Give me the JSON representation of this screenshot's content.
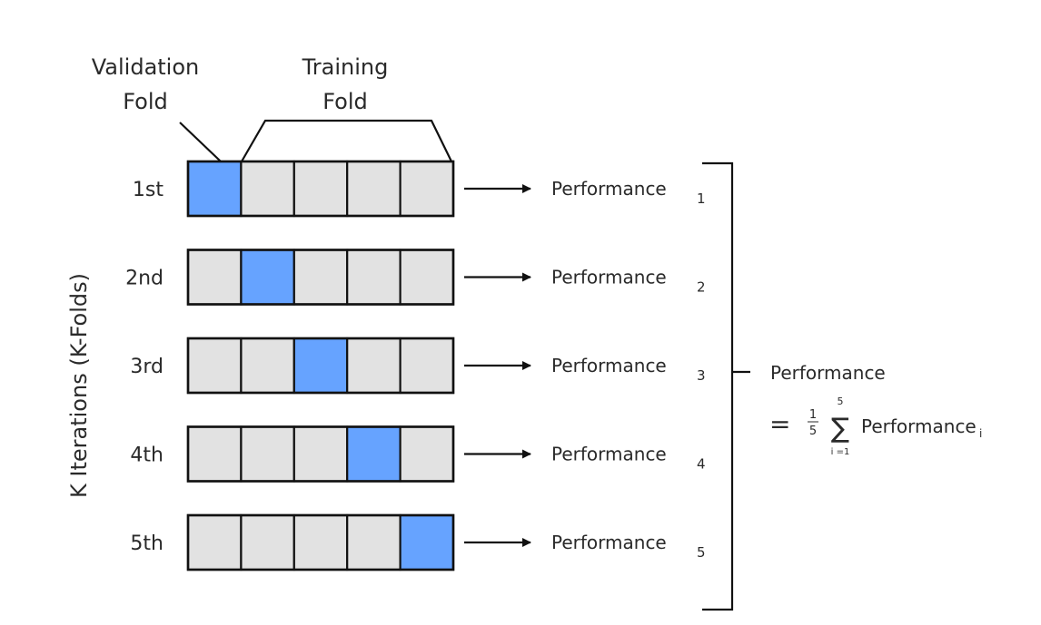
{
  "labels": {
    "validation_fold": [
      "Validation",
      "Fold"
    ],
    "training_fold": [
      "Training",
      "Fold"
    ],
    "y_axis": "K Iterations (K-Folds)",
    "performance_word": "Performance",
    "result_title": "Performance",
    "formula": {
      "equals": "=",
      "frac_num": "1",
      "frac_den": "5",
      "sum_symbol": "∑",
      "sum_upper": "5",
      "sum_lower": "i =1",
      "term": "Performance",
      "term_sub": "i"
    }
  },
  "colors": {
    "validation": "#66a3ff",
    "training": "#e2e2e2",
    "stroke": "#111111"
  },
  "num_folds": 5,
  "iterations": [
    {
      "label": "1st",
      "validation_index": 0,
      "perf_sub": "1"
    },
    {
      "label": "2nd",
      "validation_index": 1,
      "perf_sub": "2"
    },
    {
      "label": "3rd",
      "validation_index": 2,
      "perf_sub": "3"
    },
    {
      "label": "4th",
      "validation_index": 3,
      "perf_sub": "4"
    },
    {
      "label": "5th",
      "validation_index": 4,
      "perf_sub": "5"
    }
  ]
}
